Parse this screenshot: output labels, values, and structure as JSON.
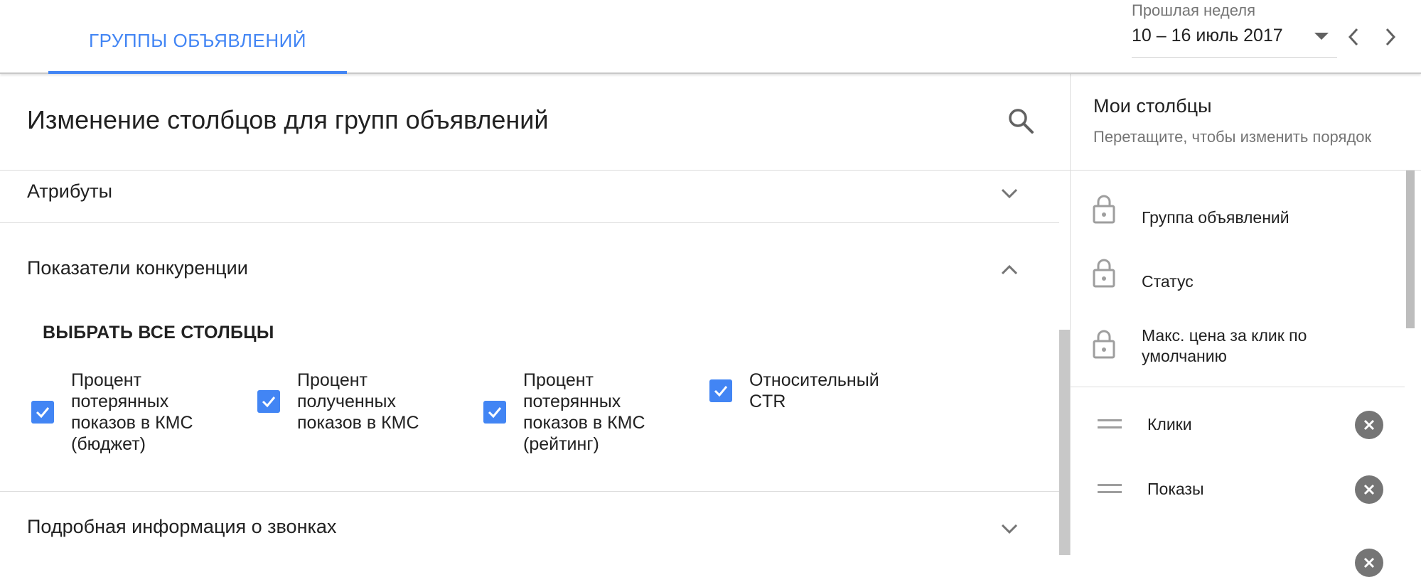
{
  "header": {
    "tab_label": "ГРУППЫ ОБЪЯВЛЕНИЙ",
    "date_caption": "Прошлая неделя",
    "date_range": "10 – 16 июль 2017"
  },
  "editor": {
    "title": "Изменение столбцов для групп объявлений",
    "sections": [
      {
        "label": "Атрибуты",
        "expanded": false
      },
      {
        "label": "Показатели конкуренции",
        "expanded": true
      },
      {
        "label": "Подробная информация о звонках",
        "expanded": false
      }
    ],
    "select_all_label": "ВЫБРАТЬ ВСЕ СТОЛБЦЫ",
    "checkboxes": [
      {
        "label": "Процент потерянных показов в КМС (бюджет)",
        "checked": true
      },
      {
        "label": "Процент полученных показов в КМС",
        "checked": true
      },
      {
        "label": "Процент потерянных показов в КМС (рейтинг)",
        "checked": true
      },
      {
        "label": "Относительный CTR",
        "checked": true
      }
    ]
  },
  "my_columns": {
    "title": "Мои столбцы",
    "subtitle": "Перетащите, чтобы изменить порядок",
    "locked": [
      {
        "label": "Группа объявлений",
        "icon": "lock-icon"
      },
      {
        "label": "Статус",
        "icon": "lock-icon"
      },
      {
        "label": "Макс. цена за клик по умолчанию",
        "icon": "lock-icon"
      }
    ],
    "selected": [
      {
        "label": "Клики"
      },
      {
        "label": "Показы"
      }
    ]
  },
  "colors": {
    "accent": "#4285f4",
    "text": "#212121",
    "secondary_text": "#757575",
    "icon_grey": "#9e9e9e"
  }
}
